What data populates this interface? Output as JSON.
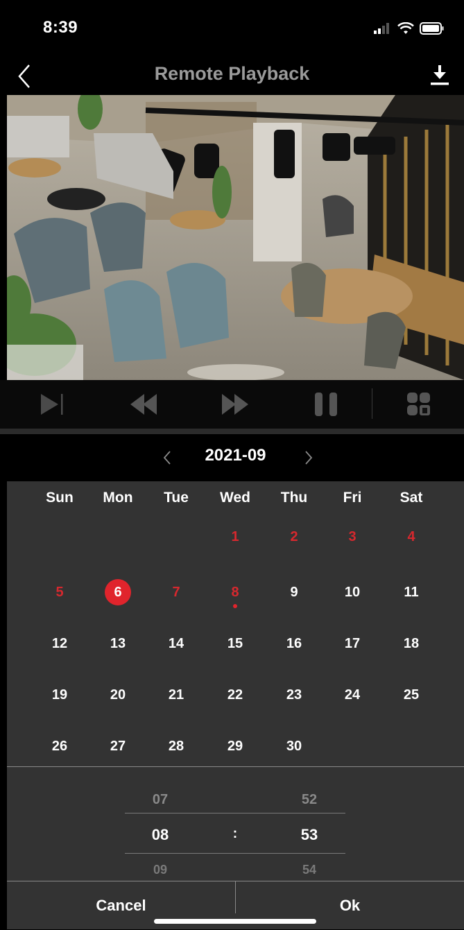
{
  "status_bar": {
    "time": "8:39"
  },
  "nav": {
    "title": "Remote Playback",
    "back_icon": "chevron-left-icon",
    "download_icon": "download-icon"
  },
  "controls": {
    "icons": [
      "step-play-icon",
      "rewind-icon",
      "fast-forward-icon",
      "pause-icon",
      "grid-multiview-icon"
    ]
  },
  "calendar": {
    "month": "2021-09",
    "weekdays": [
      "Sun",
      "Mon",
      "Tue",
      "Wed",
      "Thu",
      "Fri",
      "Sat"
    ],
    "weeks": [
      [
        "",
        "",
        "",
        "1",
        "2",
        "3",
        "4"
      ],
      [
        "5",
        "6",
        "7",
        "8",
        "9",
        "10",
        "11"
      ],
      [
        "12",
        "13",
        "14",
        "15",
        "16",
        "17",
        "18"
      ],
      [
        "19",
        "20",
        "21",
        "22",
        "23",
        "24",
        "25"
      ],
      [
        "26",
        "27",
        "28",
        "29",
        "30",
        "",
        ""
      ]
    ],
    "recorded_days": [
      "1",
      "2",
      "3",
      "4",
      "5",
      "6",
      "7",
      "8"
    ],
    "selected_day": "6",
    "marker_day": "8",
    "colors": {
      "recorded": "#d7282e",
      "selected": "#e0242c",
      "background": "#333333"
    }
  },
  "time_picker": {
    "hours": [
      "07",
      "08",
      "09"
    ],
    "minutes": [
      "52",
      "53",
      "54"
    ],
    "separator": ":"
  },
  "actions": {
    "cancel": "Cancel",
    "ok": "Ok"
  }
}
